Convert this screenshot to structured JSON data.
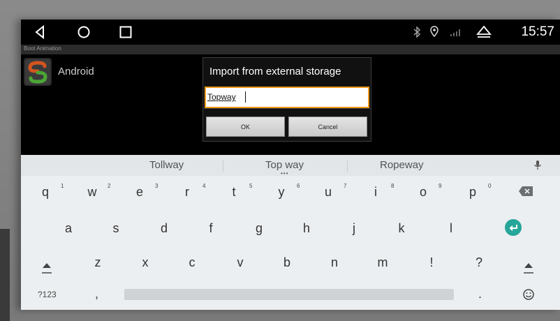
{
  "status_bar": {
    "nav_buttons": [
      "back-icon",
      "home-icon",
      "recents-icon"
    ],
    "status_icons": [
      "bluetooth-icon",
      "location-icon",
      "signal-icon",
      "eject-icon"
    ],
    "clock": "15:57"
  },
  "app": {
    "title": "Boot Animation",
    "list_items": [
      {
        "label": "Android",
        "icon": "app-logo-icon"
      }
    ]
  },
  "dialog": {
    "title": "Import from external storage",
    "input_value": "Topway",
    "ok_label": "OK",
    "cancel_label": "Cancel",
    "accent_color": "#f29a1a"
  },
  "keyboard": {
    "suggestions": [
      "Tollway",
      "Top way",
      "Ropeway"
    ],
    "row1": [
      "q",
      "w",
      "e",
      "r",
      "t",
      "y",
      "u",
      "i",
      "o",
      "p"
    ],
    "row1_hints": [
      "1",
      "2",
      "3",
      "4",
      "5",
      "6",
      "7",
      "8",
      "9",
      "0"
    ],
    "row2": [
      "a",
      "s",
      "d",
      "f",
      "g",
      "h",
      "j",
      "k",
      "l"
    ],
    "row3": [
      "z",
      "x",
      "c",
      "v",
      "b",
      "n",
      "m",
      "!",
      "?"
    ],
    "symbols_label": "?123",
    "comma": ",",
    "period": ".",
    "enter_color": "#26a69a"
  }
}
